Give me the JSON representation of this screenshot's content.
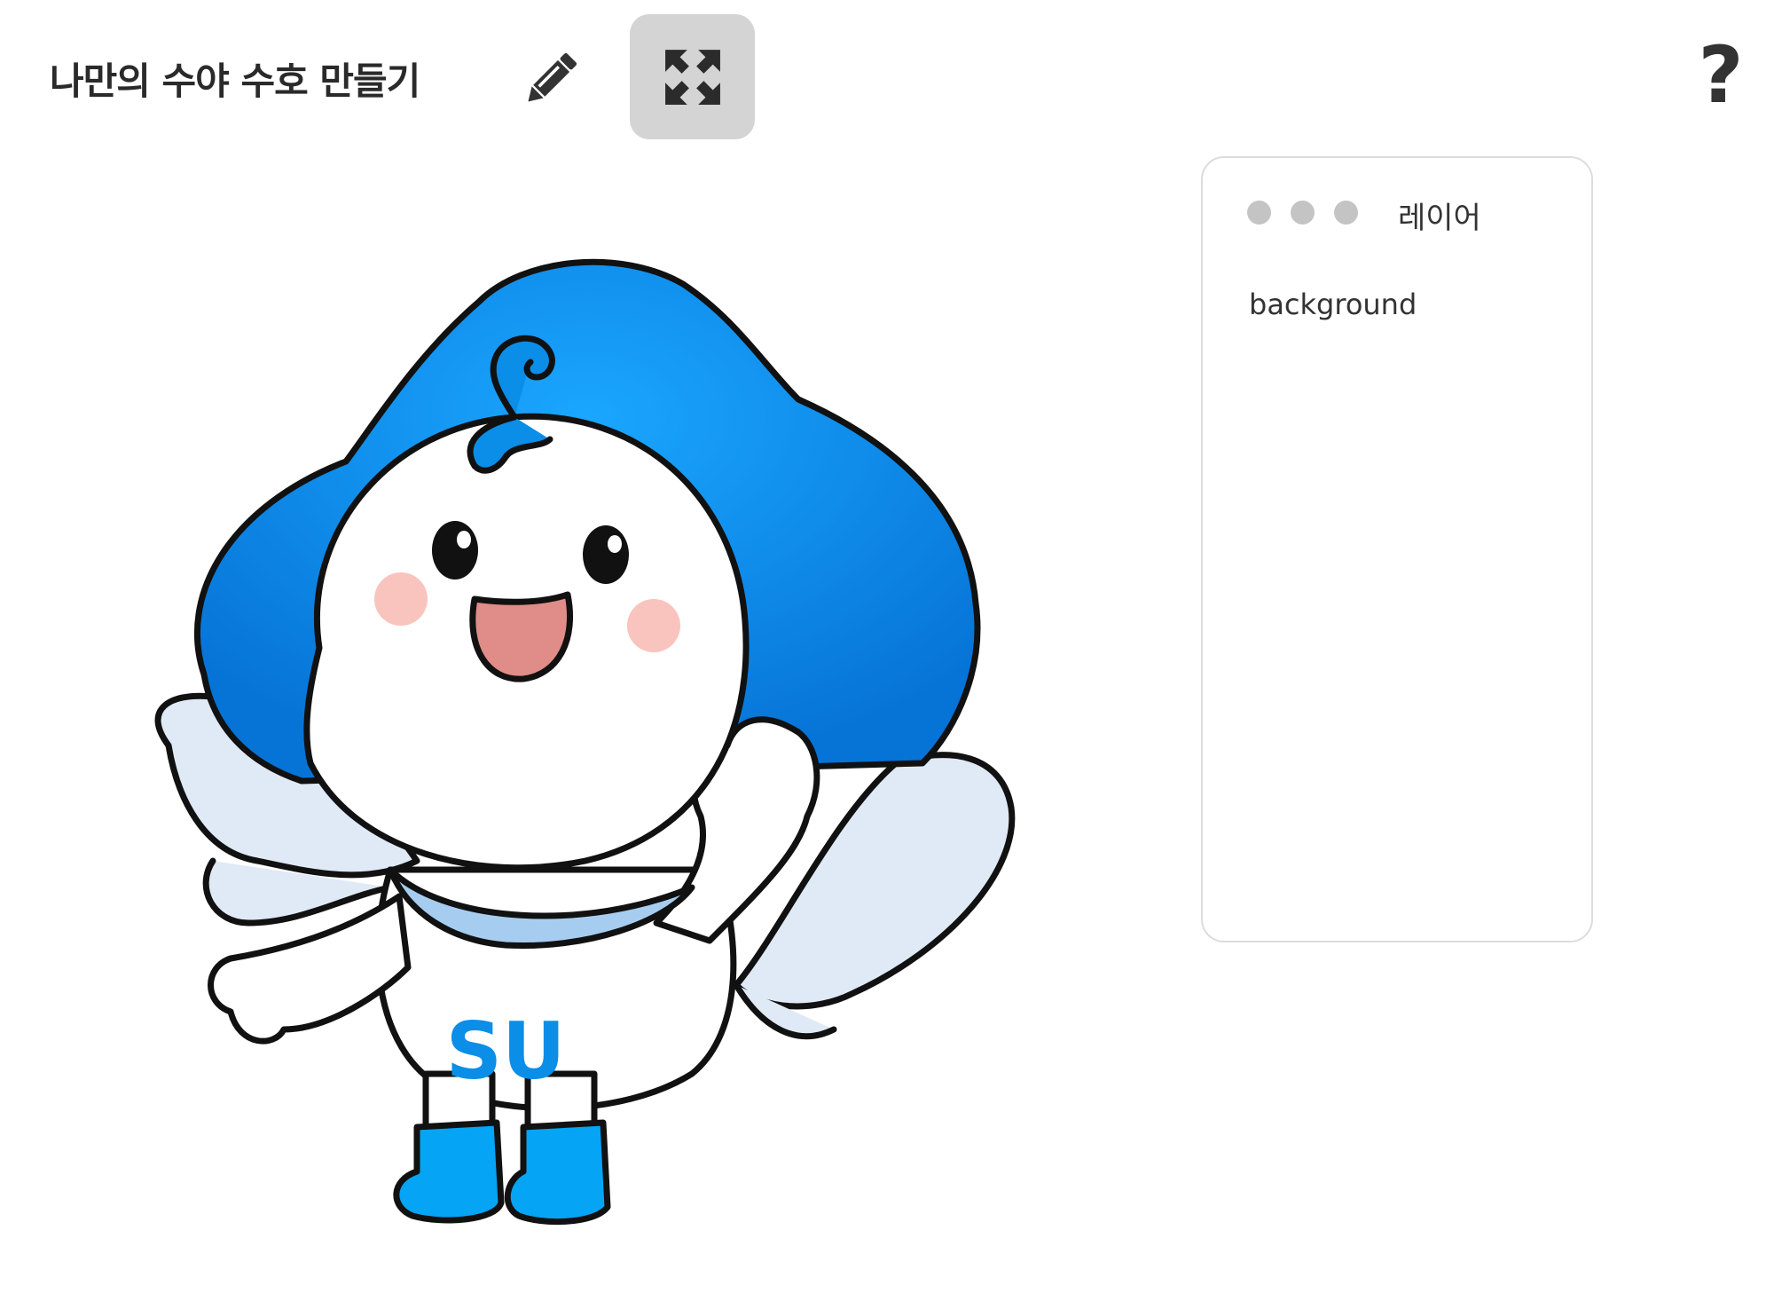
{
  "header": {
    "title": "나만의 수야 수호 만들기",
    "pencil_icon": "pencil-icon",
    "fullscreen_icon": "expand-arrows-icon",
    "help_label": "?"
  },
  "canvas": {
    "shirt_text": "SU"
  },
  "layer_panel": {
    "title": "레이어",
    "layers": [
      {
        "name": "background"
      }
    ]
  },
  "colors": {
    "accent_blue": "#0a8ee8",
    "button_bg": "#d4d4d4",
    "panel_border": "#dcdcdc",
    "dot_gray": "#c4c4c4"
  }
}
